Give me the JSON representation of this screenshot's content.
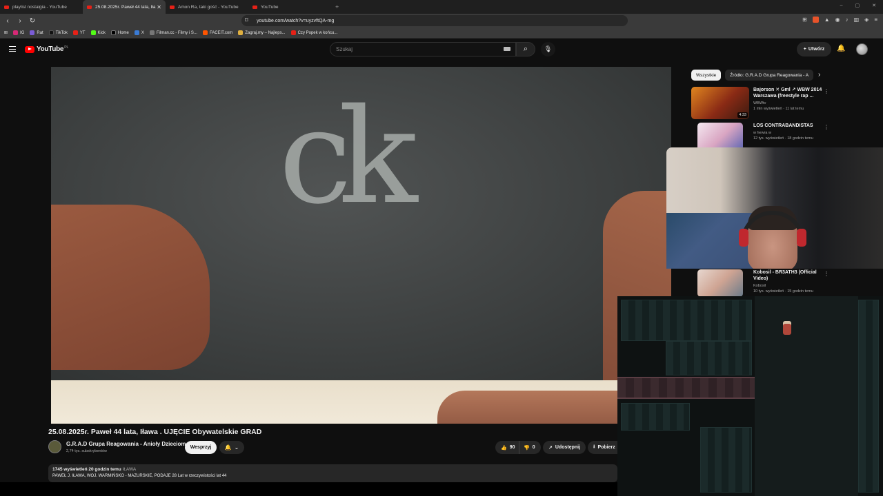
{
  "browser": {
    "tabs": [
      {
        "label": "playlist nostalgia - YouTube"
      },
      {
        "label": "25.08.2025r. Paweł 44 lata, Iła",
        "active": true
      },
      {
        "label": "Amon Ra, taki gość - YouTube"
      },
      {
        "label": "YouTube"
      }
    ],
    "url": "youtube.com/watch?v=uyzvftQA-mg",
    "bookmarks": [
      "IG",
      "Rat",
      "TikTok",
      "YT",
      "Kick",
      "Home",
      "X",
      "Filman.cc - Filmy i S...",
      "FACEIT.com",
      "Zagraj.my – Najleps...",
      "Czy Popek w końcu..."
    ]
  },
  "header": {
    "logo_text": "YouTube",
    "logo_country": "PL",
    "search_placeholder": "Szukaj",
    "create_label": "Utwórz"
  },
  "video": {
    "title": "25.08.2025r. Paweł 44 lata, Iława . UJĘCIE Obywatelskie GRAD",
    "channel_name": "G.R.A.D Grupa Reagowania - Anioły Dzieciom",
    "subscribers": "2,74 tys. subskrybentów",
    "support_label": "Wesprzyj",
    "likes": "90",
    "dislikes": "0",
    "share_label": "Udostępnij",
    "download_label": "Pobierz",
    "views_time": "1745 wyświetleń  20 godzin temu",
    "location_tag": "IŁAWA",
    "description_line": "PAWEŁ J.  IŁAWA, WOJ. WARMIŃSKO - MAZURSKIE, PODAJE 28 Lat w rzeczywistości lat 44"
  },
  "sidebar": {
    "chips": [
      "Wszystkie",
      "Źródło: G.R.A.D Grupa Reagowania - A"
    ],
    "recommendations": [
      {
        "title": "Bajorson ✕ Gml ↗ WBW 2014 Warszawa (freestyle rap ...",
        "channel": "WBWtv",
        "meta": "1 mln wyświetleń · 11 lat temu",
        "duration": "4:33"
      },
      {
        "title": "LOS CONTRABANDISTAS",
        "channel": "w hewra w",
        "meta": "12 tys. wyświetleń · 18 godzin temu",
        "duration": ""
      },
      {
        "title": "Kobosil - BR3ATH3 (Official Video)",
        "channel": "Kobosil",
        "meta": "10 tys. wyświetleń · 15 godzin temu",
        "duration": ""
      }
    ]
  },
  "colors": {
    "background": "#0f0f0f",
    "accent": "#ff0000",
    "chip_active": "#f1f1f1"
  }
}
